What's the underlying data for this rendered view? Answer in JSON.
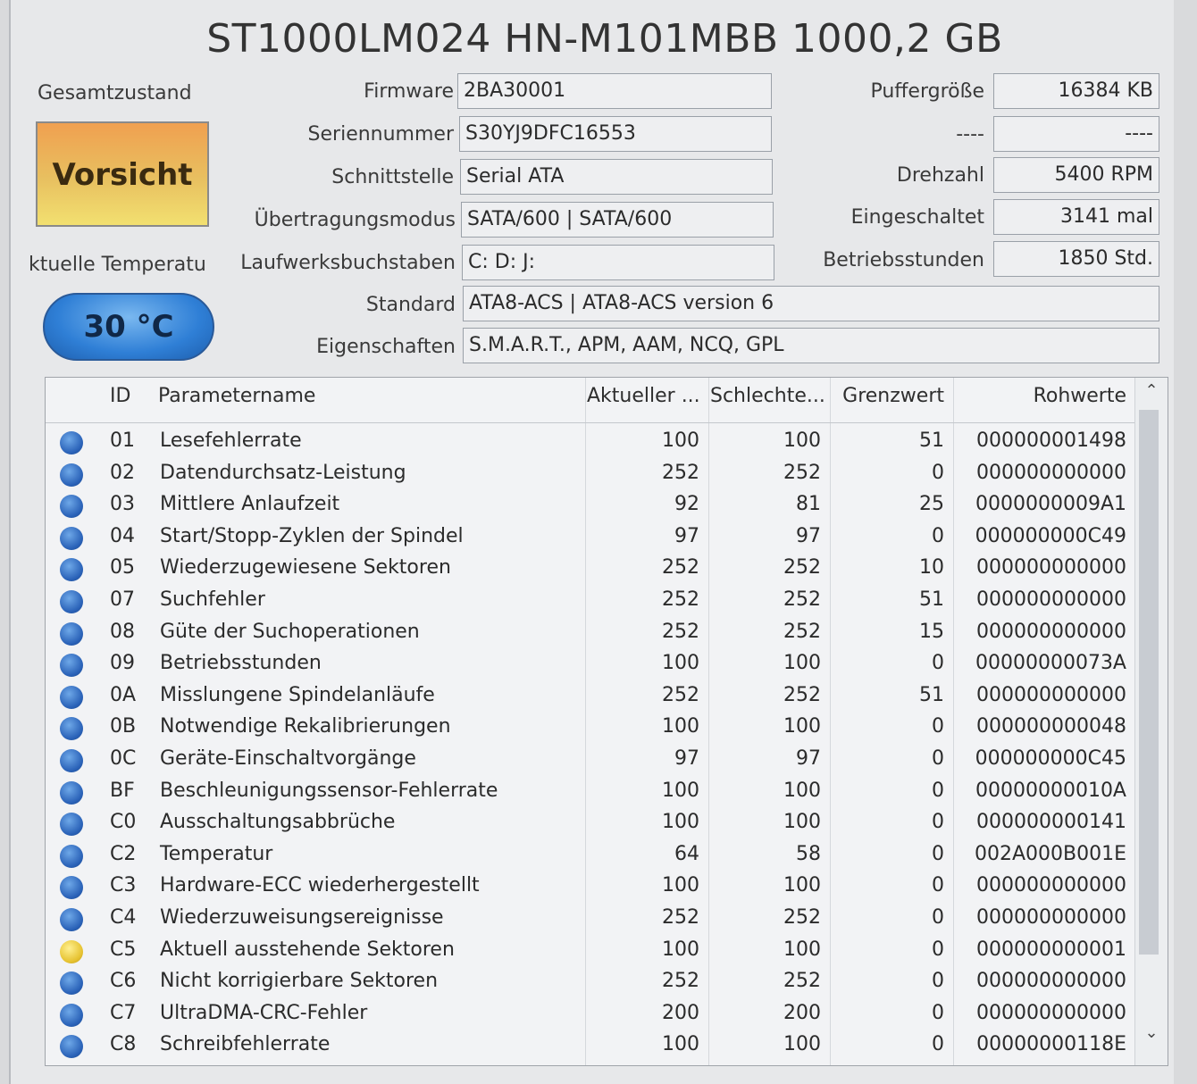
{
  "drive_title": "ST1000LM024 HN-M101MBB 1000,2 GB",
  "health": {
    "label": "Gesamtzustand",
    "status": "Vorsicht",
    "color": "#e8a64a"
  },
  "temperature": {
    "label": "ktuelle Temperatu",
    "value": "30 °C"
  },
  "info": {
    "firmware": {
      "label": "Firmware",
      "value": "2BA30001"
    },
    "serial": {
      "label": "Seriennummer",
      "value": "S30YJ9DFC16553"
    },
    "interface": {
      "label": "Schnittstelle",
      "value": "Serial ATA"
    },
    "transfer_mode": {
      "label": "Übertragungsmodus",
      "value": "SATA/600 | SATA/600"
    },
    "drive_letters": {
      "label": "Laufwerksbuchstaben",
      "value": "C: D: J:"
    },
    "standard": {
      "label": "Standard",
      "value": "ATA8-ACS | ATA8-ACS version 6"
    },
    "features": {
      "label": "Eigenschaften",
      "value": "S.M.A.R.T., APM, AAM, NCQ, GPL"
    },
    "buffer": {
      "label": "Puffergröße",
      "value": "16384 KB"
    },
    "unknown": {
      "label": "----",
      "value": "----"
    },
    "rpm": {
      "label": "Drehzahl",
      "value": "5400 RPM"
    },
    "power_on_count": {
      "label": "Eingeschaltet",
      "value": "3141 mal"
    },
    "power_on_hours": {
      "label": "Betriebsstunden",
      "value": "1850 Std."
    }
  },
  "table": {
    "headers": {
      "id": "ID",
      "name": "Parametername",
      "current": "Aktueller ...",
      "worst": "Schlechte...",
      "threshold": "Grenzwert",
      "raw": "Rohwerte"
    },
    "rows": [
      {
        "status": "good",
        "id": "01",
        "name": "Lesefehlerrate",
        "current": "100",
        "worst": "100",
        "threshold": "51",
        "raw": "000000001498"
      },
      {
        "status": "good",
        "id": "02",
        "name": "Datendurchsatz-Leistung",
        "current": "252",
        "worst": "252",
        "threshold": "0",
        "raw": "000000000000"
      },
      {
        "status": "good",
        "id": "03",
        "name": "Mittlere Anlaufzeit",
        "current": "92",
        "worst": "81",
        "threshold": "25",
        "raw": "0000000009A1"
      },
      {
        "status": "good",
        "id": "04",
        "name": "Start/Stopp-Zyklen der Spindel",
        "current": "97",
        "worst": "97",
        "threshold": "0",
        "raw": "000000000C49"
      },
      {
        "status": "good",
        "id": "05",
        "name": "Wiederzugewiesene Sektoren",
        "current": "252",
        "worst": "252",
        "threshold": "10",
        "raw": "000000000000"
      },
      {
        "status": "good",
        "id": "07",
        "name": "Suchfehler",
        "current": "252",
        "worst": "252",
        "threshold": "51",
        "raw": "000000000000"
      },
      {
        "status": "good",
        "id": "08",
        "name": "Güte der Suchoperationen",
        "current": "252",
        "worst": "252",
        "threshold": "15",
        "raw": "000000000000"
      },
      {
        "status": "good",
        "id": "09",
        "name": "Betriebsstunden",
        "current": "100",
        "worst": "100",
        "threshold": "0",
        "raw": "00000000073A"
      },
      {
        "status": "good",
        "id": "0A",
        "name": "Misslungene Spindelanläufe",
        "current": "252",
        "worst": "252",
        "threshold": "51",
        "raw": "000000000000"
      },
      {
        "status": "good",
        "id": "0B",
        "name": "Notwendige Rekalibrierungen",
        "current": "100",
        "worst": "100",
        "threshold": "0",
        "raw": "000000000048"
      },
      {
        "status": "good",
        "id": "0C",
        "name": "Geräte-Einschaltvorgänge",
        "current": "97",
        "worst": "97",
        "threshold": "0",
        "raw": "000000000C45"
      },
      {
        "status": "good",
        "id": "BF",
        "name": "Beschleunigungssensor-Fehlerrate",
        "current": "100",
        "worst": "100",
        "threshold": "0",
        "raw": "00000000010A"
      },
      {
        "status": "good",
        "id": "C0",
        "name": "Ausschaltungsabbrüche",
        "current": "100",
        "worst": "100",
        "threshold": "0",
        "raw": "000000000141"
      },
      {
        "status": "good",
        "id": "C2",
        "name": "Temperatur",
        "current": "64",
        "worst": "58",
        "threshold": "0",
        "raw": "002A000B001E"
      },
      {
        "status": "good",
        "id": "C3",
        "name": "Hardware-ECC wiederhergestellt",
        "current": "100",
        "worst": "100",
        "threshold": "0",
        "raw": "000000000000"
      },
      {
        "status": "good",
        "id": "C4",
        "name": "Wiederzuweisungsereignisse",
        "current": "252",
        "worst": "252",
        "threshold": "0",
        "raw": "000000000000"
      },
      {
        "status": "caution",
        "id": "C5",
        "name": "Aktuell ausstehende Sektoren",
        "current": "100",
        "worst": "100",
        "threshold": "0",
        "raw": "000000000001"
      },
      {
        "status": "good",
        "id": "C6",
        "name": "Nicht korrigierbare Sektoren",
        "current": "252",
        "worst": "252",
        "threshold": "0",
        "raw": "000000000000"
      },
      {
        "status": "good",
        "id": "C7",
        "name": "UltraDMA-CRC-Fehler",
        "current": "200",
        "worst": "200",
        "threshold": "0",
        "raw": "000000000000"
      },
      {
        "status": "good",
        "id": "C8",
        "name": "Schreibfehlerrate",
        "current": "100",
        "worst": "100",
        "threshold": "0",
        "raw": "00000000118E"
      }
    ]
  },
  "colors": {
    "good": "#2a62b8",
    "caution": "#e6c230"
  }
}
